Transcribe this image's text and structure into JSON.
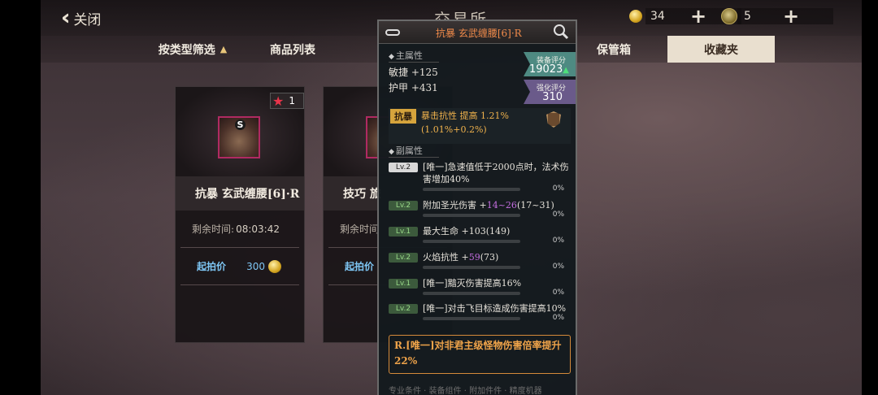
{
  "topbar": {
    "back_label": "关闭",
    "title": "交易所",
    "gold": "34",
    "gems": "5"
  },
  "tabs": [
    {
      "label": "按类型筛选"
    },
    {
      "label": "商品列表"
    },
    {
      "label": "保管箱"
    },
    {
      "label": "收藏夹"
    }
  ],
  "cards": [
    {
      "favorite_count": "1",
      "item_name": "抗暴 玄武缠腰[6]·R",
      "time_label": "剩余时间:",
      "time_value": "08:03:42",
      "bid_label": "起拍价",
      "bid_value": "300"
    },
    {
      "item_name": "技巧 旅",
      "time_label": "剩余时间",
      "bid_label": "起拍价"
    }
  ],
  "tooltip": {
    "title": "抗暴 玄武缠腰[6]·R",
    "main_section": "主属性",
    "main_stats": [
      "敏捷 +125",
      "护甲 +431"
    ],
    "equip_score_label": "装备评分",
    "equip_score": "19023",
    "enhance_score_label": "强化评分",
    "enhance_score": "310",
    "special_badge": "抗暴",
    "special_text": "暴击抗性 提高 1.21%(1.01%+0.2%)",
    "sub_section": "副属性",
    "sub_stats": [
      {
        "lv": "Lv.2",
        "text": "[唯一]急速值低于2000点时，法术伤害增加40%",
        "pct": "0%"
      },
      {
        "lv": "Lv.2",
        "text_a": "附加圣光伤害 +",
        "text_hl": "14~26",
        "text_b": "(17~31)",
        "pct": "0%"
      },
      {
        "lv": "Lv.1",
        "text": "最大生命 +103(149)",
        "pct": "0%"
      },
      {
        "lv": "Lv.2",
        "text_a": "火焰抗性 +",
        "text_hl": "59",
        "text_b": "(73)",
        "pct": "0%"
      },
      {
        "lv": "Lv.1",
        "text": "[唯一]黯灭伤害提高16%",
        "pct": "0%"
      },
      {
        "lv": "Lv.2",
        "text": "[唯一]对击飞目标造成伤害提高10%",
        "pct": "0%"
      }
    ],
    "set_effect": "R.[唯一]对非君主级怪物伤害倍率提升22%",
    "footer_fade": "专业条件 · 装备组件 · 附加件件 · 精度机器"
  },
  "colors": {
    "active_tab_bg": "#e9dfcf",
    "title_orange": "#f08a4a",
    "bid_blue": "#7ec6f4",
    "special_gold": "#d6a43c",
    "set_effect_orange": "#f0a44a",
    "score_green": "#4e8a82",
    "score_purple": "#6a5a8a"
  },
  "icons": {
    "back": "double-chevron-left-icon",
    "gold": "gold-coin-icon",
    "gems": "gem-icon",
    "favorite": "star-icon",
    "search": "magnifier-icon",
    "compare": "shield-icon"
  }
}
